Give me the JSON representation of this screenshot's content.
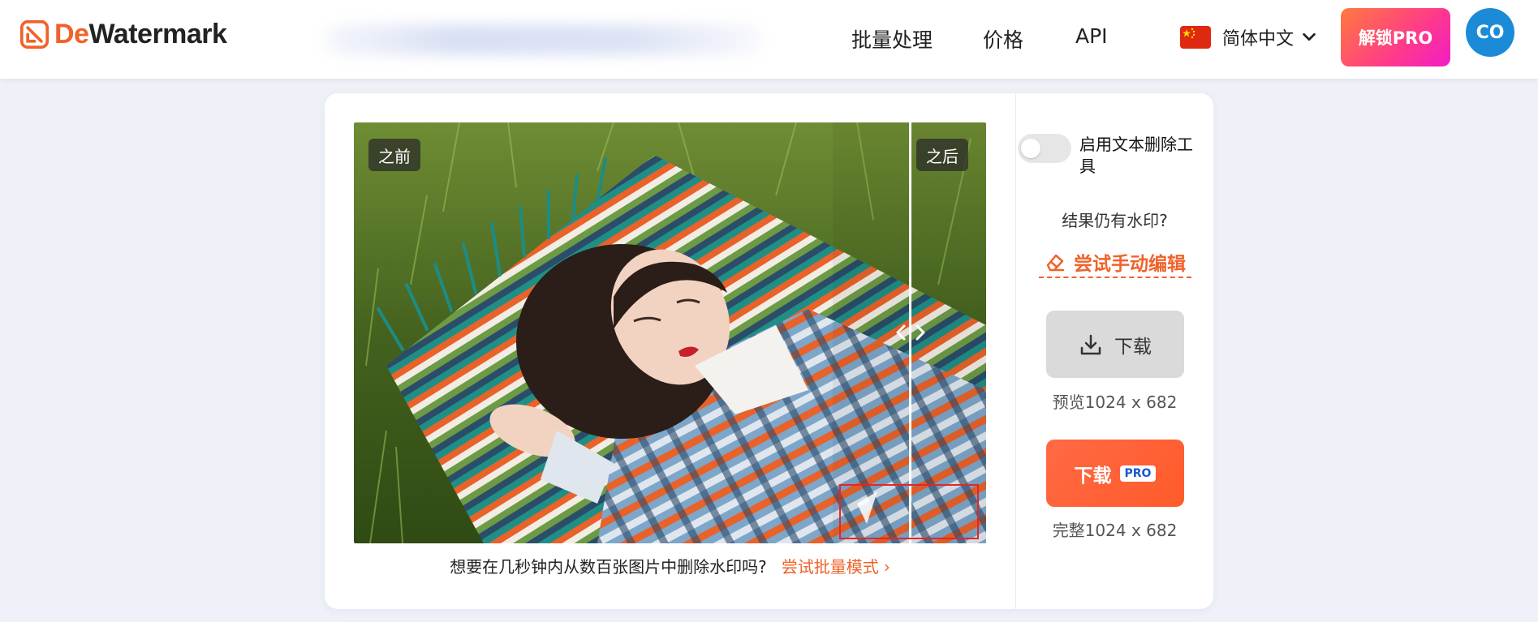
{
  "header": {
    "logo": {
      "prefix": "De",
      "suffix": "Watermark"
    },
    "nav": [
      {
        "label": "批量处理"
      },
      {
        "label": "价格"
      },
      {
        "label": "API"
      }
    ],
    "language": {
      "label": "简体中文"
    },
    "unlock_label": "解锁PRO",
    "avatar_initials": "CO"
  },
  "editor": {
    "before_label": "之前",
    "after_label": "之后",
    "batch_prompt": "想要在几秒钟内从数百张图片中删除水印吗?",
    "batch_link": "尝试批量模式",
    "batch_chevron": "›"
  },
  "panel": {
    "text_tool_label": "启用文本删除工具",
    "still_watermark": "结果仍有水印?",
    "manual_edit": "尝试手动编辑",
    "download_label": "下载",
    "preview_size": "预览1024 x 682",
    "download_pro_label": "下载",
    "pro_badge": "PRO",
    "full_size": "完整1024 x 682"
  },
  "colors": {
    "accent": "#f0622a",
    "avatar": "#1b8bd8",
    "pro_badge_text": "#1a57d6",
    "watermark_box": "#e3262a"
  }
}
